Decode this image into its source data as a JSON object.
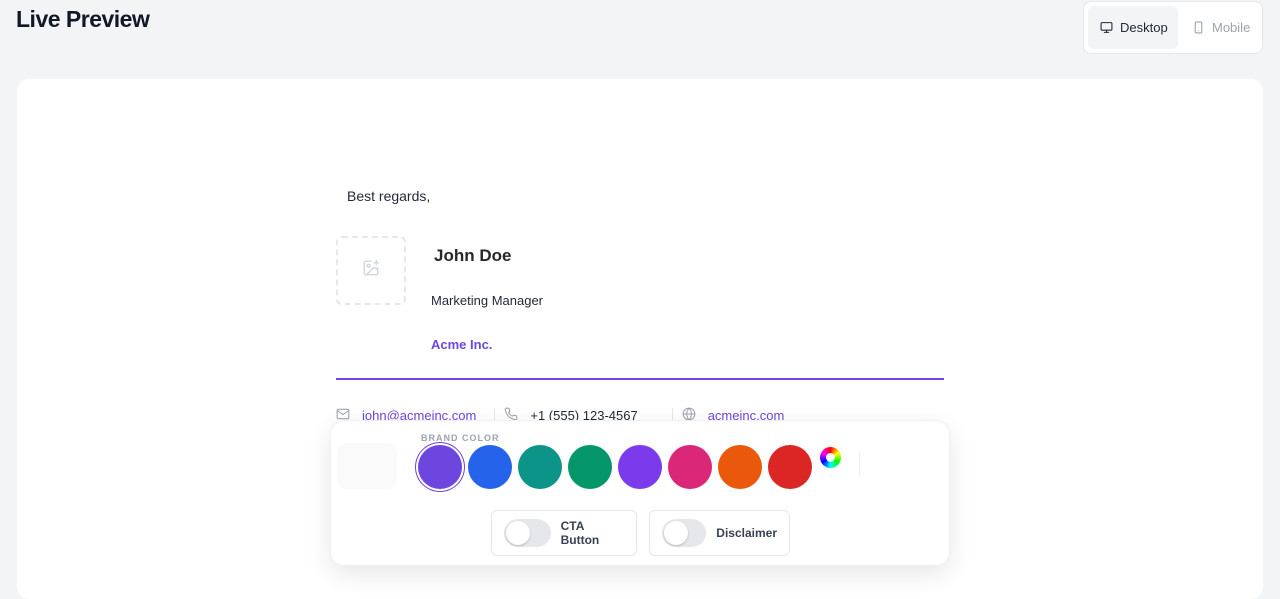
{
  "header": {
    "title": "Live Preview",
    "view_modes": [
      {
        "label": "Desktop",
        "icon": "monitor-icon",
        "active": true
      },
      {
        "label": "Mobile",
        "icon": "smartphone-icon",
        "active": false
      }
    ]
  },
  "signature": {
    "greeting": "Best regards,",
    "photo_icon": "image-plus-icon",
    "name": "John Doe",
    "job_title": "Marketing Manager",
    "company": "Acme Inc.",
    "accent_color": "#6d46e0",
    "contacts": [
      {
        "icon": "mail-icon",
        "text": "john@acmeinc.com",
        "link": true
      },
      {
        "icon": "phone-icon",
        "text": "+1 (555) 123-4567",
        "link": false
      },
      {
        "icon": "globe-icon",
        "text": "acmeinc.com",
        "link": true
      }
    ]
  },
  "toolbar": {
    "brand_color_label": "BRAND COLOR",
    "swatches": [
      "#6d46e0",
      "#2563eb",
      "#0d9488",
      "#059669",
      "#7c3aed",
      "#db2777",
      "#ea580c",
      "#dc2626"
    ],
    "selected_swatch": "#6d46e0",
    "custom_color_icon": "color-wheel-icon",
    "toggles": [
      {
        "label": "CTA Button",
        "on": false
      },
      {
        "label": "Disclaimer",
        "on": false
      }
    ]
  }
}
